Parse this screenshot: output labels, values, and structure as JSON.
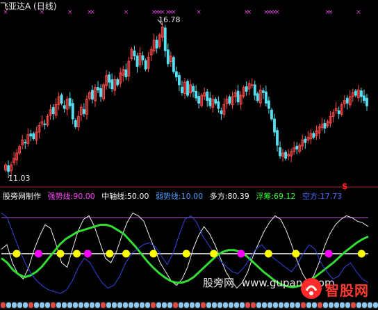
{
  "title": "飞亚达A (日线)",
  "price_labels": {
    "high": "16.78",
    "low": "11.03"
  },
  "signal_mark": "$",
  "indicator_legend": [
    {
      "text": "股旁网制作",
      "color": "#ffffff"
    },
    {
      "text": "强势线:90.00",
      "color": "#ff44ff"
    },
    {
      "text": "中轴线:50.00",
      "color": "#ffffff"
    },
    {
      "text": "弱势线:10.00",
      "color": "#4aa0ff"
    },
    {
      "text": "多方:80.39",
      "color": "#ffffff"
    },
    {
      "text": "浮筹:69.12",
      "color": "#33ff33"
    },
    {
      "text": "空方:17.73",
      "color": "#4a6cff"
    }
  ],
  "watermark": {
    "cn": "股旁网",
    "url": "www.gupang.com"
  },
  "brand": "智股网",
  "colors": {
    "up": "#ff4a4a",
    "down": "#54e0f0",
    "strong_line": "#b05bd0",
    "mid_line": "#ffffff",
    "float": "#33dd33",
    "bull": "#f0f0f0",
    "bear": "#3344dd",
    "dot_yellow": "#ffff00",
    "dot_magenta": "#ff00ff"
  },
  "chart_data": [
    {
      "type": "candlestick",
      "title": "飞亚达A (日线)",
      "annotations": [
        "16.78",
        "11.03"
      ],
      "price_high": 16.78,
      "price_low": 11.03,
      "ylim": [
        10.9,
        17.2
      ],
      "n_bars": 130,
      "closes": [
        11.45,
        11.2,
        11.45,
        11.7,
        11.9,
        12.15,
        12.4,
        12.3,
        12.6,
        12.55,
        12.45,
        12.7,
        12.95,
        13.1,
        13.0,
        13.3,
        13.55,
        13.4,
        13.75,
        14.05,
        13.8,
        13.6,
        13.95,
        13.7,
        13.2,
        12.9,
        13.3,
        13.65,
        13.4,
        13.95,
        14.2,
        13.95,
        14.4,
        14.3,
        14.05,
        14.5,
        14.85,
        14.6,
        14.35,
        14.7,
        14.5,
        14.95,
        15.1,
        14.8,
        15.4,
        15.85,
        15.6,
        15.2,
        15.7,
        15.45,
        15.1,
        15.55,
        15.85,
        16.2,
        15.9,
        16.4,
        16.7,
        15.8,
        15.3,
        15.6,
        15.0,
        14.8,
        14.5,
        14.2,
        14.6,
        14.1,
        14.5,
        14.25,
        14.0,
        13.8,
        14.1,
        14.2,
        13.9,
        13.7,
        13.95,
        13.8,
        13.6,
        13.4,
        13.75,
        13.95,
        13.8,
        14.05,
        14.2,
        13.85,
        14.1,
        14.4,
        14.25,
        14.55,
        14.5,
        14.1,
        13.9,
        14.3,
        14.2,
        13.8,
        13.6,
        13.2,
        12.7,
        12.2,
        11.8,
        11.9,
        11.7,
        11.85,
        11.95,
        12.1,
        12.05,
        12.2,
        12.4,
        12.3,
        12.5,
        12.65,
        12.5,
        12.75,
        12.9,
        13.0,
        12.85,
        13.1,
        13.3,
        13.45,
        13.6,
        13.4,
        13.75,
        13.9,
        13.8,
        14.05,
        14.2,
        14.1,
        14.3,
        14.05,
        13.9,
        13.7
      ],
      "top_signal_bars": [
        0,
        13,
        23,
        30,
        31,
        43,
        53,
        54,
        55,
        56,
        58,
        59,
        60,
        69,
        86,
        87,
        93,
        94,
        95,
        96,
        97,
        115,
        116,
        126
      ]
    },
    {
      "type": "line",
      "title": "",
      "ylim": [
        0,
        100
      ],
      "reference_lines": [
        {
          "name": "强势线",
          "value": 90
        },
        {
          "name": "中轴线",
          "value": 50
        },
        {
          "name": "弱势线",
          "value": 10
        }
      ],
      "series": [
        {
          "name": "多方",
          "last": 80.39,
          "values": [
            55,
            60,
            40,
            28,
            22,
            35,
            55,
            70,
            82,
            78,
            60,
            40,
            35,
            55,
            75,
            88,
            92,
            80,
            62,
            45,
            40,
            52,
            70,
            85,
            95,
            92,
            86,
            70,
            55,
            40,
            30,
            20,
            15,
            22,
            35,
            55,
            70,
            80,
            72,
            60,
            45,
            30,
            20,
            12,
            18,
            30,
            48,
            62,
            75,
            85,
            92,
            88,
            76,
            60,
            42,
            28,
            18,
            25,
            40,
            58,
            72,
            82,
            88,
            92,
            90,
            86,
            84,
            80
          ]
        },
        {
          "name": "浮筹",
          "last": 69.12,
          "values": [
            45,
            40,
            32,
            27,
            24,
            26,
            30,
            36,
            44,
            52,
            60,
            66,
            70,
            74,
            76,
            78,
            80,
            82,
            82,
            80,
            76,
            72,
            65,
            58,
            50,
            42,
            35,
            29,
            24,
            20,
            18,
            18,
            20,
            24,
            30,
            36,
            42,
            48,
            52,
            54,
            54,
            52,
            48,
            42,
            36,
            30,
            25,
            20,
            16,
            14,
            13,
            14,
            16,
            20,
            25,
            30,
            35,
            40,
            46,
            52,
            57,
            62,
            66,
            69
          ]
        },
        {
          "name": "空方",
          "last": 17.73,
          "values": [
            95,
            90,
            72,
            55,
            40,
            28,
            20,
            14,
            10,
            8,
            6,
            10,
            20,
            35,
            45,
            40,
            28,
            18,
            12,
            15,
            25,
            40,
            50,
            55,
            60,
            62,
            58,
            48,
            38,
            50,
            70,
            88,
            92,
            85,
            70,
            60,
            50,
            42,
            36,
            30,
            28,
            35,
            45,
            55,
            60,
            52,
            45,
            40,
            35,
            30,
            38,
            50,
            60,
            55,
            40,
            30,
            22,
            25,
            35,
            40,
            30,
            22,
            18
          ]
        }
      ],
      "center_dots": [
        {
          "index": 1,
          "color": "yellow"
        },
        {
          "index": 5,
          "color": "magenta"
        },
        {
          "index": 9,
          "color": "yellow"
        },
        {
          "index": 12,
          "color": "yellow"
        },
        {
          "index": 14,
          "color": "magenta"
        },
        {
          "index": 18,
          "color": "yellow"
        },
        {
          "index": 21,
          "color": "yellow"
        },
        {
          "index": 26,
          "color": "yellow"
        },
        {
          "index": 32,
          "color": "yellow"
        },
        {
          "index": 37,
          "color": "yellow"
        },
        {
          "index": 42,
          "color": "magenta"
        },
        {
          "index": 47,
          "color": "yellow"
        },
        {
          "index": 52,
          "color": "yellow"
        },
        {
          "index": 58,
          "color": "magenta"
        },
        {
          "index": 64,
          "color": "yellow"
        }
      ]
    }
  ]
}
